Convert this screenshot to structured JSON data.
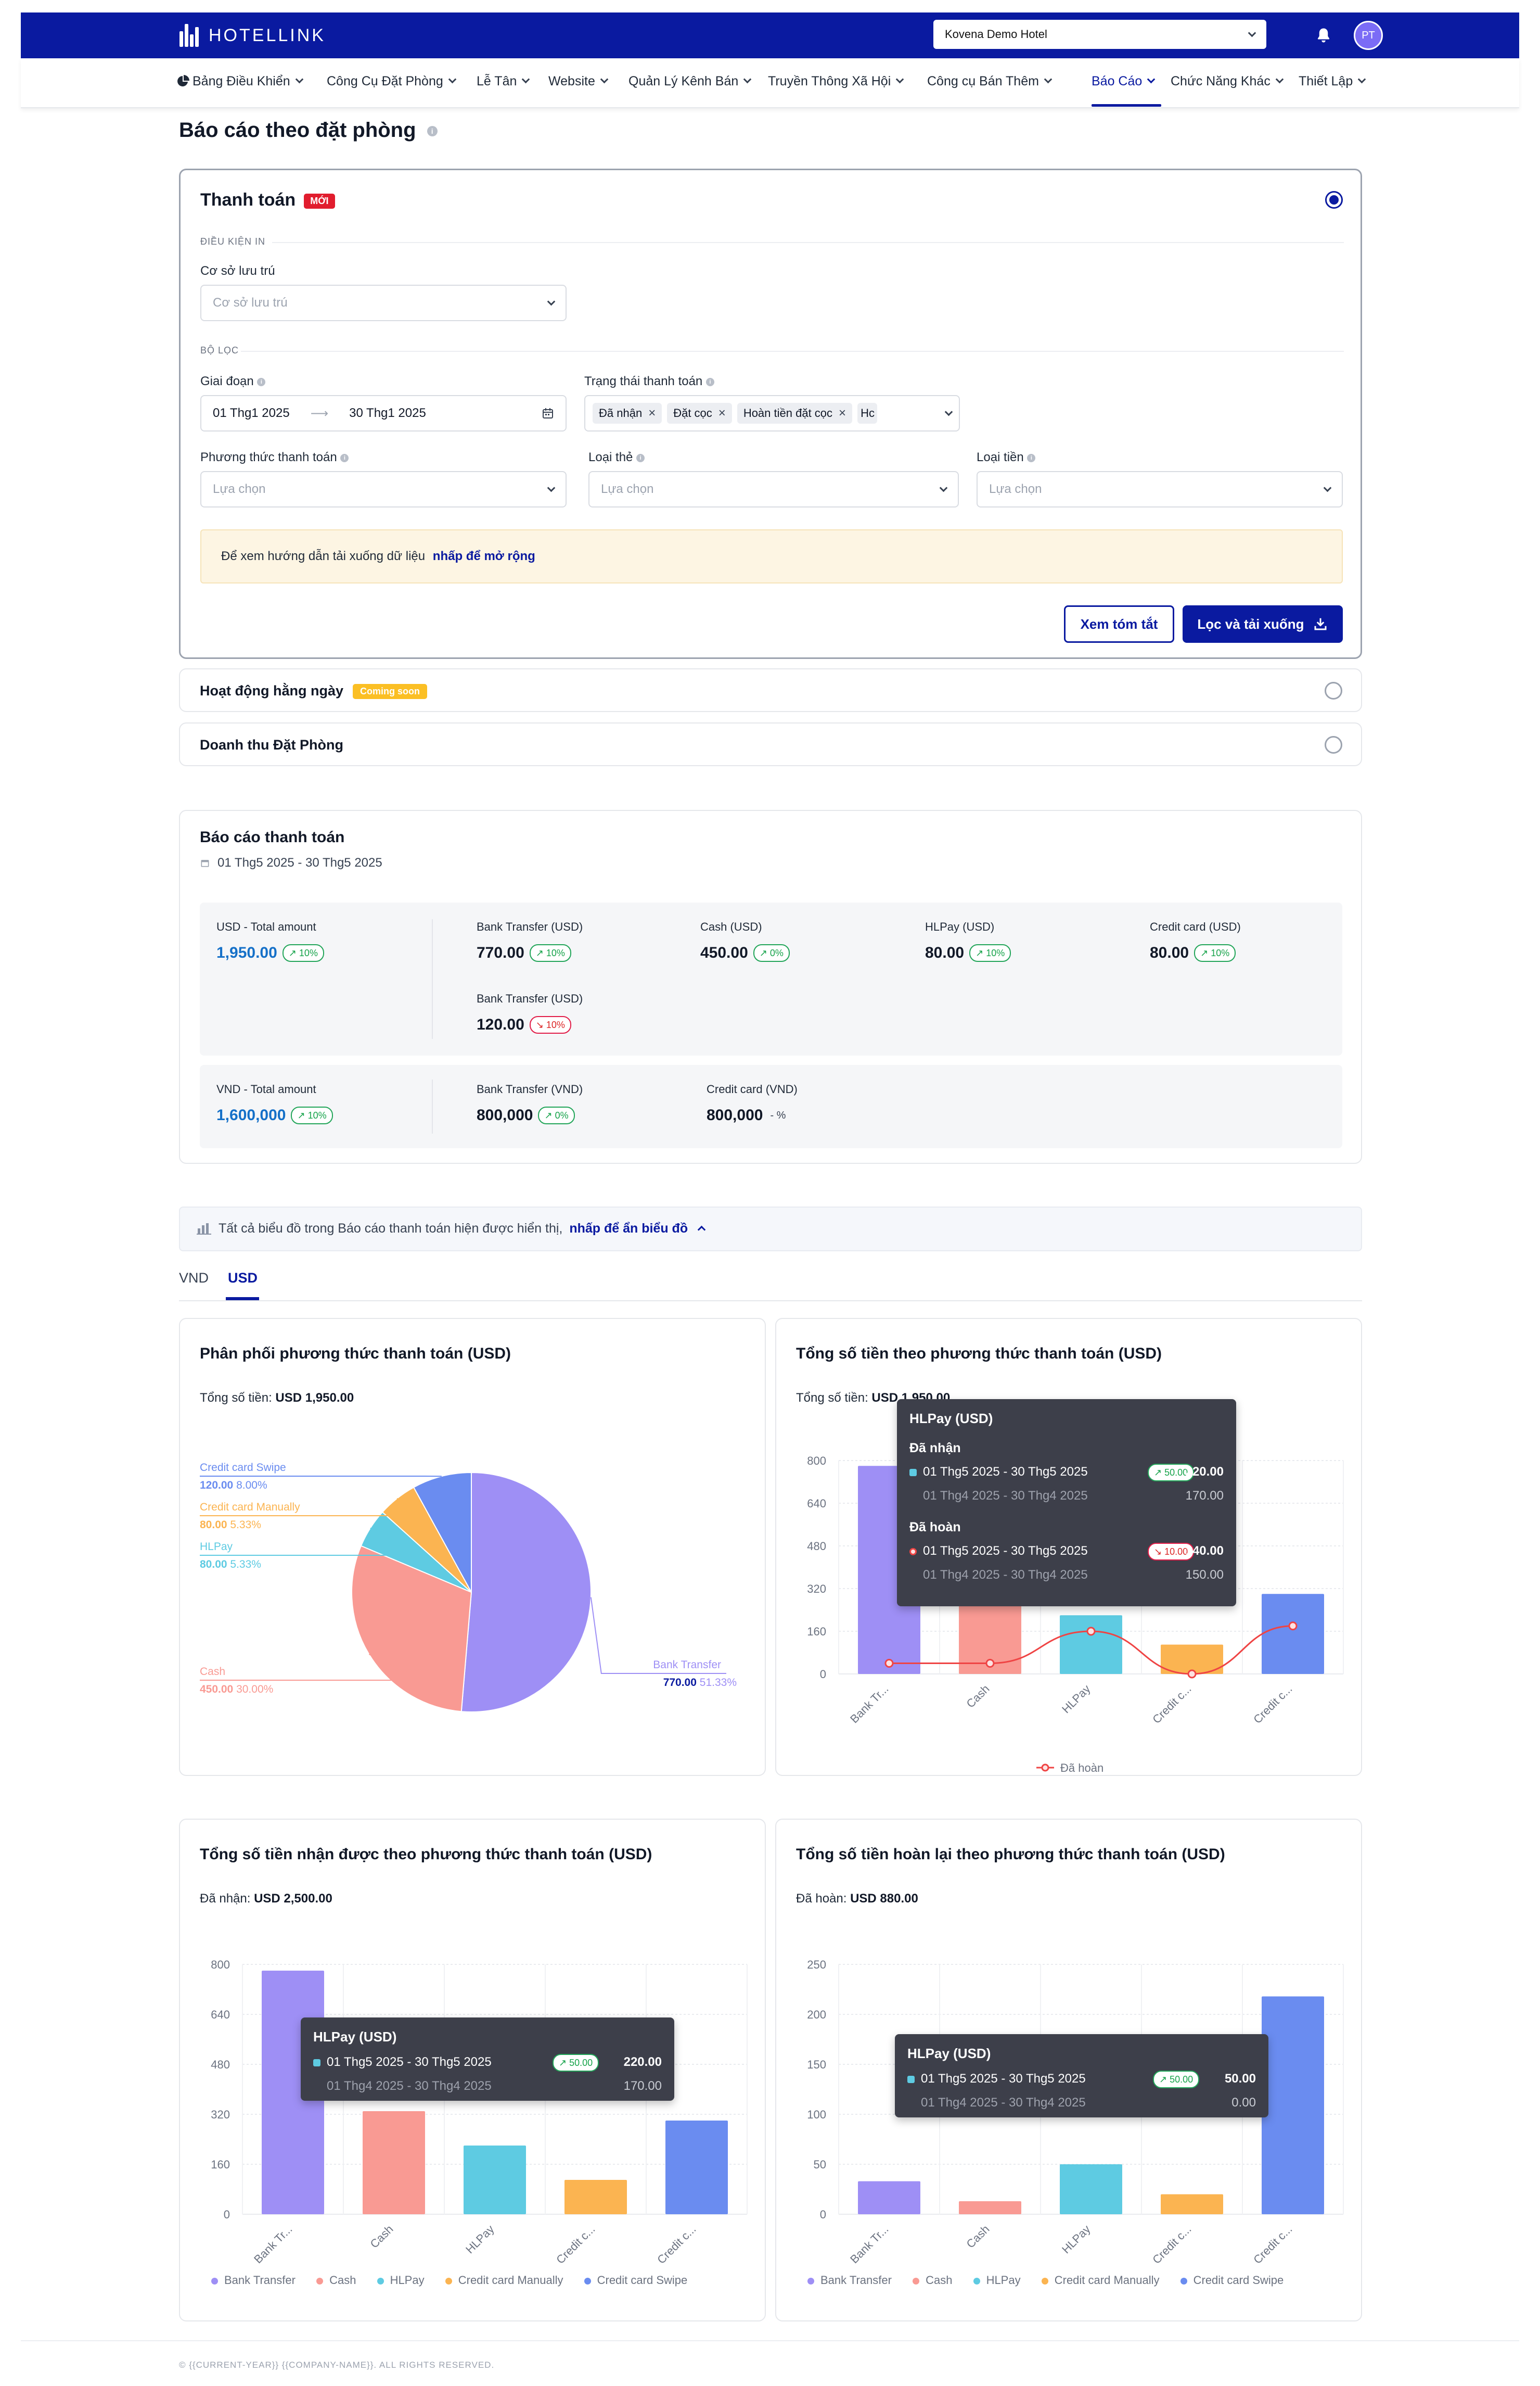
{
  "app": {
    "brand": "HOTELLINK",
    "hotel": "Kovena Demo Hotel",
    "user_initials": "PT"
  },
  "nav": [
    {
      "label": "Bảng Điều Khiển"
    },
    {
      "label": "Công Cụ Đặt Phòng"
    },
    {
      "label": "Lễ Tân"
    },
    {
      "label": "Website"
    },
    {
      "label": "Quản Lý Kênh Bán"
    },
    {
      "label": "Truyền Thông Xã Hội"
    },
    {
      "label": "Công cụ Bán Thêm"
    },
    {
      "label": "Báo Cáo"
    },
    {
      "label": "Chức Năng Khác"
    },
    {
      "label": "Thiết Lập"
    }
  ],
  "page": {
    "title": "Báo cáo theo đặt phòng"
  },
  "payment_card": {
    "title": "Thanh toán",
    "badge": "MỚI",
    "conditions_label": "ĐIỀU KIỆN IN",
    "property_label": "Cơ sở lưu trú",
    "property_placeholder": "Cơ sở lưu trú",
    "filters_label": "BỘ LỌC",
    "period_label": "Giai đoạn",
    "period_start": "01 Thg1 2025",
    "period_end": "30 Thg1 2025",
    "status_label": "Trạng thái thanh toán",
    "status_tags": [
      "Đã nhận",
      "Đặt cọc",
      "Hoàn tiền đặt cọc",
      "Hc"
    ],
    "method_label": "Phương thức thanh toán",
    "card_type_label": "Loại thẻ",
    "currency_label": "Loại tiền",
    "select_placeholder": "Lựa chọn",
    "notice_text": "Để xem hướng dẫn tải xuống dữ liệu",
    "notice_link": "nhấp để mở rộng",
    "btn_summary": "Xem tóm tắt",
    "btn_download": "Lọc và tải xuống"
  },
  "other_reports": [
    {
      "title": "Hoạt động hằng ngày",
      "badge": "Coming soon"
    },
    {
      "title": "Doanh thu Đặt Phòng"
    }
  ],
  "summary": {
    "title": "Báo cáo thanh toán",
    "range": "01 Thg5 2025 - 30 Thg5 2025",
    "usd": {
      "total_label": "USD - Total amount",
      "total_value": "1,950.00",
      "total_change": "10%",
      "items": [
        {
          "label": "Bank Transfer (USD)",
          "value": "770.00",
          "change": "10%",
          "dir": "up"
        },
        {
          "label": "Cash (USD)",
          "value": "450.00",
          "change": "0%",
          "dir": "up"
        },
        {
          "label": "HLPay (USD)",
          "value": "80.00",
          "change": "10%",
          "dir": "up"
        },
        {
          "label": "Credit card (USD)",
          "value": "80.00",
          "change": "10%",
          "dir": "up"
        },
        {
          "label": "Bank Transfer (USD)",
          "value": "120.00",
          "change": "10%",
          "dir": "down"
        }
      ]
    },
    "vnd": {
      "total_label": "VND - Total amount",
      "total_value": "1,600,000",
      "total_change": "10%",
      "items": [
        {
          "label": "Bank Transfer (VND)",
          "value": "800,000",
          "change": "0%",
          "dir": "up"
        },
        {
          "label": "Credit card (VND)",
          "value": "800,000",
          "change": "- %",
          "dir": "flat"
        }
      ]
    }
  },
  "chart_notice": {
    "text": "Tất cả biểu đồ trong Báo cáo thanh toán hiện được hiển thị,",
    "link": "nhấp để ẩn biểu đồ"
  },
  "currency_tabs": [
    "VND",
    "USD"
  ],
  "colors": {
    "bank_transfer": "#9e8ff5",
    "cash": "#f99a93",
    "hlpay": "#5ecbe2",
    "cc_manually": "#fbb451",
    "cc_swipe": "#6a8cf0",
    "accent": "#0a1aa0"
  },
  "chart_data": [
    {
      "type": "pie",
      "title": "Phân phối phương thức thanh toán (USD)",
      "subtitle_label": "Tổng số tiền:",
      "subtitle_value": "USD 1,950.00",
      "slices": [
        {
          "name": "Bank Transfer",
          "value": 770.0,
          "percent": "51.33%",
          "value_text": "770.00"
        },
        {
          "name": "Cash",
          "value": 450.0,
          "percent": "30.00%",
          "value_text": "450.00"
        },
        {
          "name": "HLPay",
          "value": 80.0,
          "percent": "5.33%",
          "value_text": "80.00"
        },
        {
          "name": "Credit card Manually",
          "value": 80.0,
          "percent": "5.33%",
          "value_text": "80.00"
        },
        {
          "name": "Credit card Swipe",
          "value": 120.0,
          "percent": "8.00%",
          "value_text": "120.00"
        }
      ]
    },
    {
      "type": "bar",
      "title": "Tổng số tiền theo phương thức thanh toán (USD)",
      "subtitle_label": "Tổng số tiền:",
      "subtitle_value": "USD 1,950.00",
      "categories": [
        "Bank Tr...",
        "Cash",
        "HLPay",
        "Credit c...",
        "Credit c..."
      ],
      "yticks": [
        0,
        160,
        320,
        480,
        640,
        800
      ],
      "ylim": [
        0,
        800
      ],
      "series": [
        {
          "values": [
            780,
            450,
            220,
            110,
            300
          ]
        },
        {
          "name": "Đã hoàn",
          "type": "line",
          "values": [
            40,
            40,
            160,
            0,
            180
          ]
        }
      ],
      "tooltip": {
        "title": "HLPay (USD)",
        "groups": [
          {
            "heading": "Đã nhận",
            "current_range": "01 Thg5 2025 - 30 Thg5 2025",
            "change": "50.00",
            "dir": "up",
            "current": "220.00",
            "previous_range": "01 Thg4 2025 - 30 Thg4 2025",
            "previous": "170.00"
          },
          {
            "heading": "Đã hoàn",
            "current_range": "01 Thg5 2025 - 30 Thg5 2025",
            "change": "10.00",
            "dir": "down",
            "current": "140.00",
            "previous_range": "01 Thg4 2025 - 30 Thg4 2025",
            "previous": "150.00"
          }
        ]
      }
    },
    {
      "type": "bar",
      "title": "Tổng số tiền nhận được theo phương thức thanh toán (USD)",
      "subtitle_label": "Đã nhận:",
      "subtitle_value": "USD 2,500.00",
      "categories": [
        "Bank Tr...",
        "Cash",
        "HLPay",
        "Credit c...",
        "Credit c..."
      ],
      "yticks": [
        0,
        160,
        320,
        480,
        640,
        800
      ],
      "ylim": [
        0,
        800
      ],
      "values": [
        780,
        330,
        220,
        110,
        300
      ],
      "legend": [
        "Bank Transfer",
        "Cash",
        "HLPay",
        "Credit card Manually",
        "Credit card Swipe"
      ],
      "tooltip": {
        "title": "HLPay (USD)",
        "current_range": "01 Thg5 2025 - 30 Thg5 2025",
        "change": "50.00",
        "current": "220.00",
        "previous_range": "01 Thg4 2025 - 30 Thg4 2025",
        "previous": "170.00"
      }
    },
    {
      "type": "bar",
      "title": "Tổng số tiền hoàn lại theo phương thức thanh toán (USD)",
      "subtitle_label": "Đã hoàn:",
      "subtitle_value": "USD 880.00",
      "categories": [
        "Bank Tr...",
        "Cash",
        "HLPay",
        "Credit c...",
        "Credit c..."
      ],
      "yticks": [
        0,
        50,
        100,
        150,
        200,
        250
      ],
      "ylim": [
        0,
        250
      ],
      "values": [
        33,
        13,
        50,
        20,
        218
      ],
      "legend": [
        "Bank Transfer",
        "Cash",
        "HLPay",
        "Credit card Manually",
        "Credit card Swipe"
      ],
      "tooltip": {
        "title": "HLPay (USD)",
        "current_range": "01 Thg5 2025 - 30 Thg5 2025",
        "change": "50.00",
        "current": "50.00",
        "previous_range": "01 Thg4 2025 - 30 Thg4 2025",
        "previous": "0.00"
      }
    }
  ],
  "footer": {
    "text": "© {{CURRENT-YEAR}} {{COMPANY-NAME}}. ALL RIGHTS RESERVED."
  }
}
